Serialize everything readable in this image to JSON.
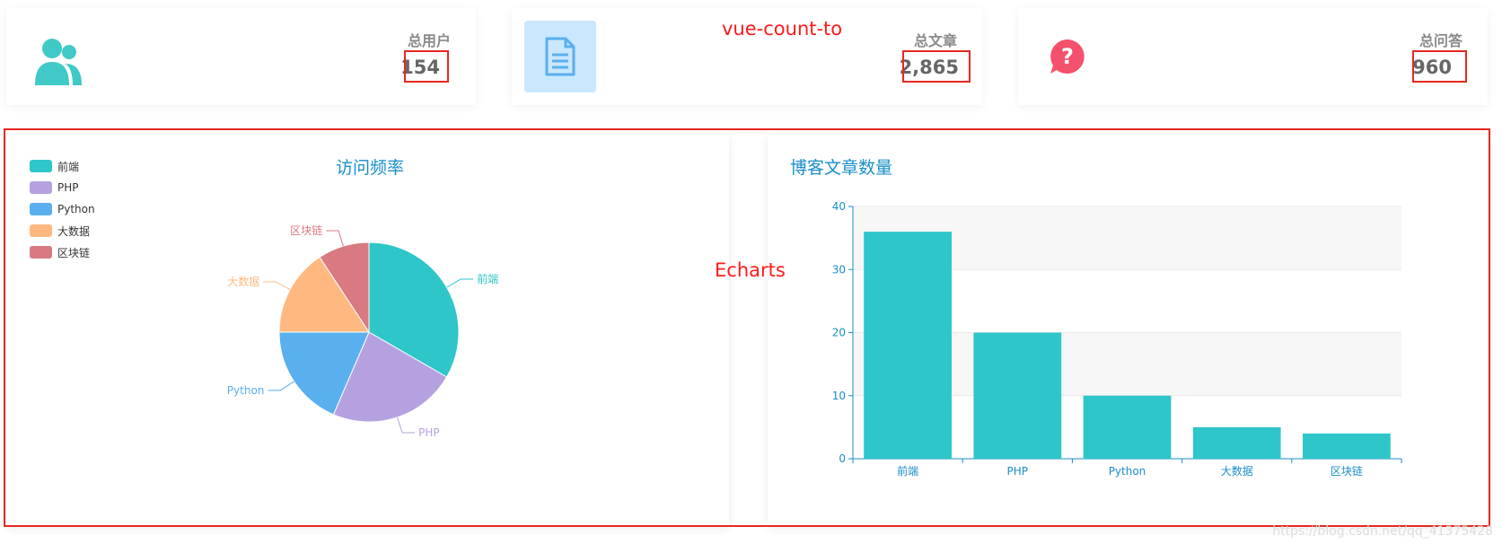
{
  "stats": {
    "users": {
      "label": "总用户",
      "value": "154"
    },
    "articles": {
      "label": "总文章",
      "value": "2,865"
    },
    "questions": {
      "label": "总问答",
      "value": "960"
    }
  },
  "annotations": {
    "count": "vue-count-to",
    "charts": "Echarts"
  },
  "chart_data": [
    {
      "type": "pie",
      "title": "访问频率",
      "legend_position": "top-left",
      "categories": [
        "前端",
        "PHP",
        "Python",
        "大数据",
        "区块链"
      ],
      "values": [
        36,
        25,
        20,
        17,
        10
      ],
      "colors": [
        "#2ec6c9",
        "#b5a1e0",
        "#5aafef",
        "#ffb980",
        "#d87a80"
      ]
    },
    {
      "type": "bar",
      "title": "博客文章数量",
      "categories": [
        "前端",
        "PHP",
        "Python",
        "大数据",
        "区块链"
      ],
      "values": [
        36,
        20,
        10,
        5,
        4
      ],
      "ylim": [
        0,
        40
      ],
      "yticks": [
        "0",
        "10",
        "20",
        "30",
        "40"
      ],
      "color": "#2ec6c9",
      "grid": true
    }
  ],
  "watermark": "https://blog.csdn.net/qq_41375428"
}
